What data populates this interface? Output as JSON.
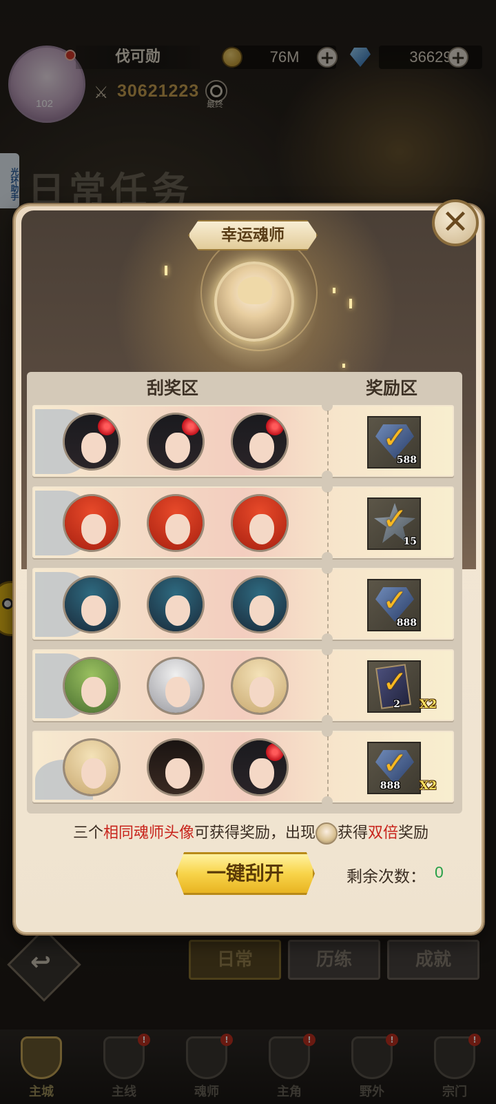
{
  "topbar": {
    "player_name": "伐可勋",
    "level": "102",
    "coins": "76M",
    "gems": "36629",
    "power": "30621223",
    "search_label": "最终"
  },
  "side_helper": "光环助手",
  "background_title": "日常任务",
  "bottom_tabs": [
    "日常",
    "历练",
    "成就"
  ],
  "navbar": {
    "items": [
      {
        "label": "主城",
        "icon": "castle-icon",
        "active": true
      },
      {
        "label": "主线",
        "icon": "mainline-icon"
      },
      {
        "label": "魂师",
        "icon": "soulmaster-icon"
      },
      {
        "label": "主角",
        "icon": "hero-icon"
      },
      {
        "label": "野外",
        "icon": "wild-icon"
      },
      {
        "label": "宗门",
        "icon": "sect-icon"
      }
    ]
  },
  "dialog": {
    "title": "幸运魂师",
    "close": "✕",
    "col_scratch": "刮奖区",
    "col_reward": "奖励区",
    "rows": [
      {
        "faces": [
          "red-flower-girl",
          "red-flower-girl",
          "red-flower-girl"
        ],
        "reward": "gem",
        "qty": "588",
        "mult": ""
      },
      {
        "faces": [
          "red-hair-boy",
          "red-hair-boy",
          "red-hair-boy"
        ],
        "reward": "star",
        "qty": "15",
        "mult": ""
      },
      {
        "faces": [
          "blue-hair-boy",
          "blue-hair-boy",
          "blue-hair-boy"
        ],
        "reward": "gem",
        "qty": "888",
        "mult": ""
      },
      {
        "faces": [
          "green-hair-girl",
          "white-hair-man",
          "blonde-girl"
        ],
        "reward": "card",
        "qty": "2",
        "mult": "X2"
      },
      {
        "faces": [
          "blonde-girl",
          "black-hair-man",
          "red-flower-girl"
        ],
        "reward": "gem",
        "qty": "888",
        "mult": "X2"
      }
    ],
    "hint_part1": "三个",
    "hint_red1": "相同魂师头像",
    "hint_part2": "可获得奖励，出现",
    "hint_part3": "获得",
    "hint_red2": "双倍",
    "hint_part4": "奖励",
    "open_button": "一键刮开",
    "remain_label": "剩余次数：",
    "remain_value": "0"
  },
  "colors": {
    "accent_gold": "#f8d44a",
    "highlight_red": "#c8241c",
    "count_green": "#28a048"
  }
}
